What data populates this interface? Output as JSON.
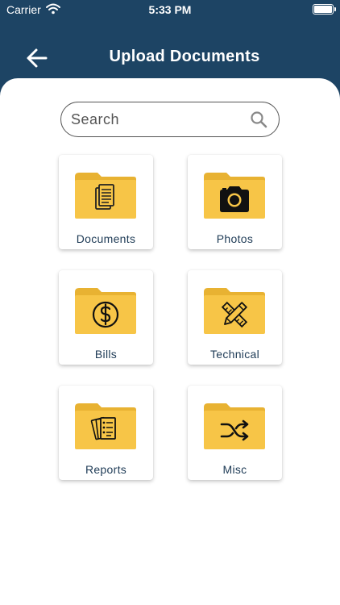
{
  "status_bar": {
    "carrier": "Carrier",
    "time": "5:33 PM"
  },
  "header": {
    "title": "Upload Documents",
    "back_icon": "arrow-left-icon"
  },
  "search": {
    "placeholder": "Search",
    "value": ""
  },
  "colors": {
    "header_bg": "#1d4464",
    "folder": "#f7c547",
    "folder_tab": "#e8b232",
    "label": "#1d3a55"
  },
  "categories": [
    {
      "label": "Documents",
      "icon": "documents-icon"
    },
    {
      "label": "Photos",
      "icon": "camera-icon"
    },
    {
      "label": "Bills",
      "icon": "dollar-icon"
    },
    {
      "label": "Technical",
      "icon": "ruler-pencil-icon"
    },
    {
      "label": "Reports",
      "icon": "reports-icon"
    },
    {
      "label": "Misc",
      "icon": "shuffle-icon"
    }
  ]
}
